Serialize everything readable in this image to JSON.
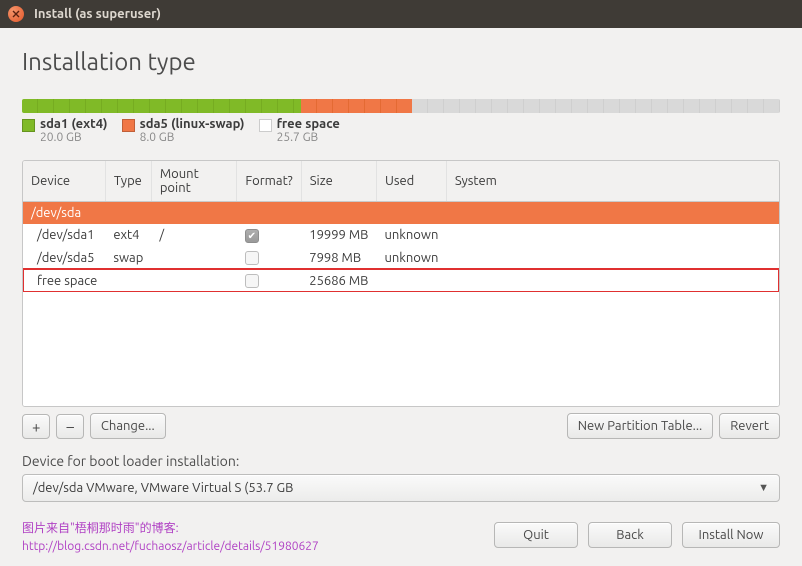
{
  "window": {
    "title": "Install (as superuser)"
  },
  "heading": "Installation type",
  "legend": {
    "sda1": {
      "label": "sda1 (ext4)",
      "size": "20.0 GB"
    },
    "sda5": {
      "label": "sda5 (linux-swap)",
      "size": "8.0 GB"
    },
    "free": {
      "label": "free space",
      "size": "25.7 GB"
    }
  },
  "columns": {
    "device": "Device",
    "type": "Type",
    "mount": "Mount point",
    "format": "Format?",
    "size": "Size",
    "used": "Used",
    "system": "System"
  },
  "disk_row": "/dev/sda",
  "rows": [
    {
      "device": "/dev/sda1",
      "type": "ext4",
      "mount": "/",
      "format": true,
      "size": "19999 MB",
      "used": "unknown",
      "system": ""
    },
    {
      "device": "/dev/sda5",
      "type": "swap",
      "mount": "",
      "format": false,
      "size": "7998 MB",
      "used": "unknown",
      "system": ""
    },
    {
      "device": "free space",
      "type": "",
      "mount": "",
      "format": false,
      "size": "25686 MB",
      "used": "",
      "system": ""
    }
  ],
  "toolbar": {
    "add": "+",
    "remove": "–",
    "change": "Change...",
    "new_partition_table": "New Partition Table...",
    "revert": "Revert"
  },
  "boot": {
    "label": "Device for boot loader installation:",
    "value": "/dev/sda   VMware, VMware Virtual S (53.7 GB"
  },
  "footer": {
    "quit": "Quit",
    "back": "Back",
    "install": "Install Now"
  },
  "watermark": {
    "l1": "图片来自\"梧桐那时雨\"的博客:",
    "l2": "http://blog.csdn.net/fuchaosz/article/details/51980627"
  }
}
